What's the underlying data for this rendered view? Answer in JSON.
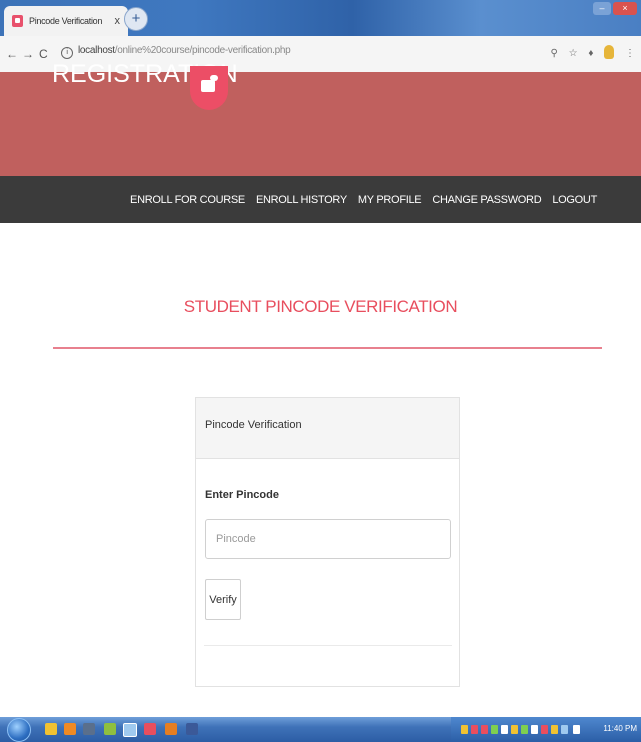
{
  "browser": {
    "tab_title": "Pincode Verification",
    "tab_close": "x",
    "new_tab": "+",
    "url_host": "localhost",
    "url_path": "/online%20course/pincode-verification.php",
    "window_controls": {
      "minimize": "–",
      "close": "×"
    }
  },
  "nav": {
    "back": "←",
    "forward": "→",
    "reload": "C"
  },
  "site": {
    "brand": "REGISTRATION",
    "brand_icon": "briefcase-icon",
    "header_color": "#c0605e",
    "accent_color": "#e84e5e"
  },
  "menu": {
    "items": [
      {
        "label": "ENROLL FOR COURSE"
      },
      {
        "label": "ENROLL HISTORY"
      },
      {
        "label": "MY PROFILE"
      },
      {
        "label": "CHANGE PASSWORD"
      },
      {
        "label": "LOGOUT"
      }
    ]
  },
  "page": {
    "heading": "STUDENT PINCODE VERIFICATION"
  },
  "panel": {
    "heading": "Pincode Verification",
    "label": "Enter Pincode",
    "input_value": "",
    "input_placeholder": "Pincode",
    "button_label": "Verify"
  },
  "taskbar": {
    "clock": "11:40 PM"
  }
}
